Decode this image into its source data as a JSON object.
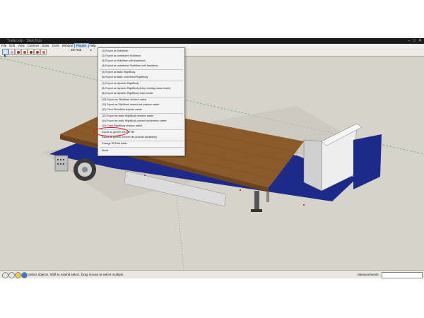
{
  "window": {
    "title": "Trailer.skp - SketchUp",
    "controls": [
      "–",
      "□",
      "✕"
    ]
  },
  "menubar": {
    "items": [
      "File",
      "Edit",
      "View",
      "Camera",
      "Draw",
      "Tools",
      "Window",
      "Plugins",
      "Help"
    ],
    "active": "Plugins"
  },
  "toolbar": {
    "tools": [
      "select-icon",
      "eraser-icon",
      "paint-icon",
      "orbit-icon",
      "pan-icon",
      "zoom-icon",
      "paint-bucket-icon"
    ],
    "submenu_label": "3D Rad",
    "submenu_arrow": "▸"
  },
  "plugins_menu": {
    "items": [
      "(1) Export as SkinMesh",
      "(2) Export as untextured SkinMesh",
      "(3) Export as SkinMesh with backfaces",
      "(4) Export as untextured SkinMesh with backfaces",
      "(5) Export as static RigidBody",
      "(6) Export as static untextured RigidBody",
      "(7) Export as dynamic RigidBody",
      "(8) Export as dynamic RigidBody (keep existing mass model)",
      "(9) Export as dynamic RigidBody mass model",
      "(10) Export as SkinMesh shadow caster",
      "(11) Export as SkinMesh closed-hull shadow caster",
      "(12) Clear SkinMesh shadow caster",
      "(13) Export as static RigidBody shadow caster",
      "(14) Export as static RigidBody closed-hull shadow caster",
      "(15) Clear RigidBody shadow caster",
      "Export as generic DirectX file",
      "Export as generic DirectX file (include backfaces)",
      "Change 3D Rad folder",
      "About"
    ],
    "highlighted": "Export as generic DirectX file"
  },
  "statusbar": {
    "text": "Select objects. Shift to extend select. Drag mouse to select multiple.",
    "measurements_label": "Measurements",
    "measurements_value": ""
  },
  "colors": {
    "deck_wood": "#8a5a28",
    "chassis_blue": "#1e2a8a",
    "highlight_ellipse": "#d7141a",
    "sky": "#d9d5cc"
  }
}
